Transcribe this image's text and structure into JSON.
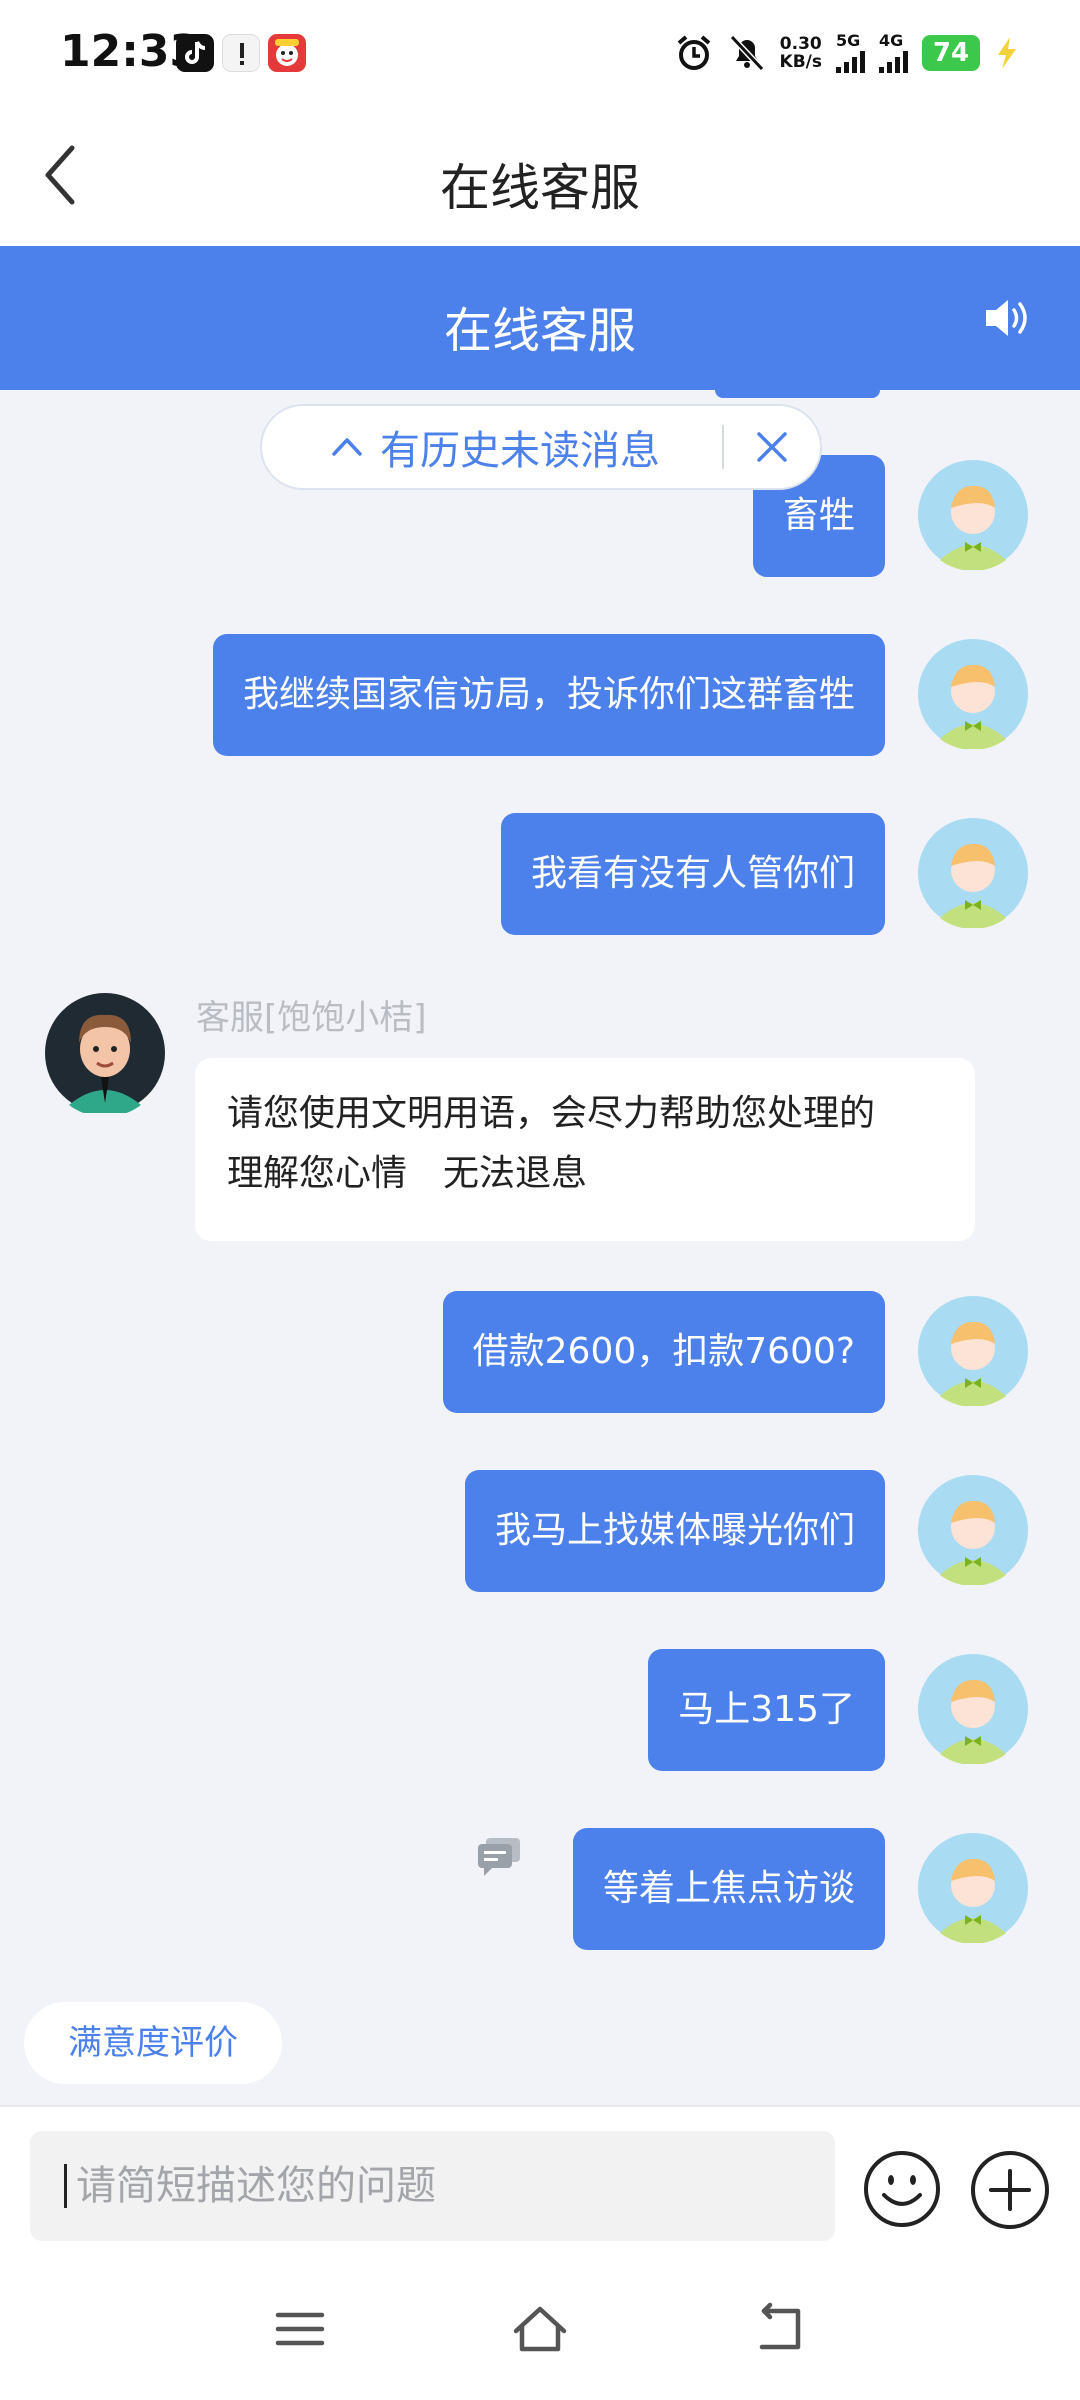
{
  "status_bar": {
    "time": "12:33",
    "net_speed": "0.30",
    "net_speed_unit": "KB/s",
    "sim1_label": "5G",
    "sim2_label": "4G",
    "battery": "74",
    "icons": [
      "tiktok-icon",
      "notification-app-icon",
      "game-app-icon",
      "alarm-icon",
      "mute-bell-icon",
      "signal-icon",
      "charging-icon"
    ]
  },
  "nav": {
    "title": "在线客服"
  },
  "header": {
    "title": "在线客服",
    "accent": "#4c80ea"
  },
  "history_banner": {
    "text": "有历史未读消息"
  },
  "messages": {
    "user1": "畜牲",
    "user2": "我继续国家信访局，投诉你们这群畜牲",
    "user3": "我看有没有人管你们",
    "agent_name": "客服[饱饱小桔]",
    "agent_line1": "请您使用文明用语，会尽力帮助您处理的",
    "agent_line2": "理解您心情　无法退息",
    "user4": "借款2600，扣款7600?",
    "user5": "我马上找媒体曝光你们",
    "user6": "马上315了",
    "user7": "等着上焦点访谈"
  },
  "rating": {
    "label": "满意度评价"
  },
  "composer": {
    "placeholder": "请简短描述您的问题"
  }
}
